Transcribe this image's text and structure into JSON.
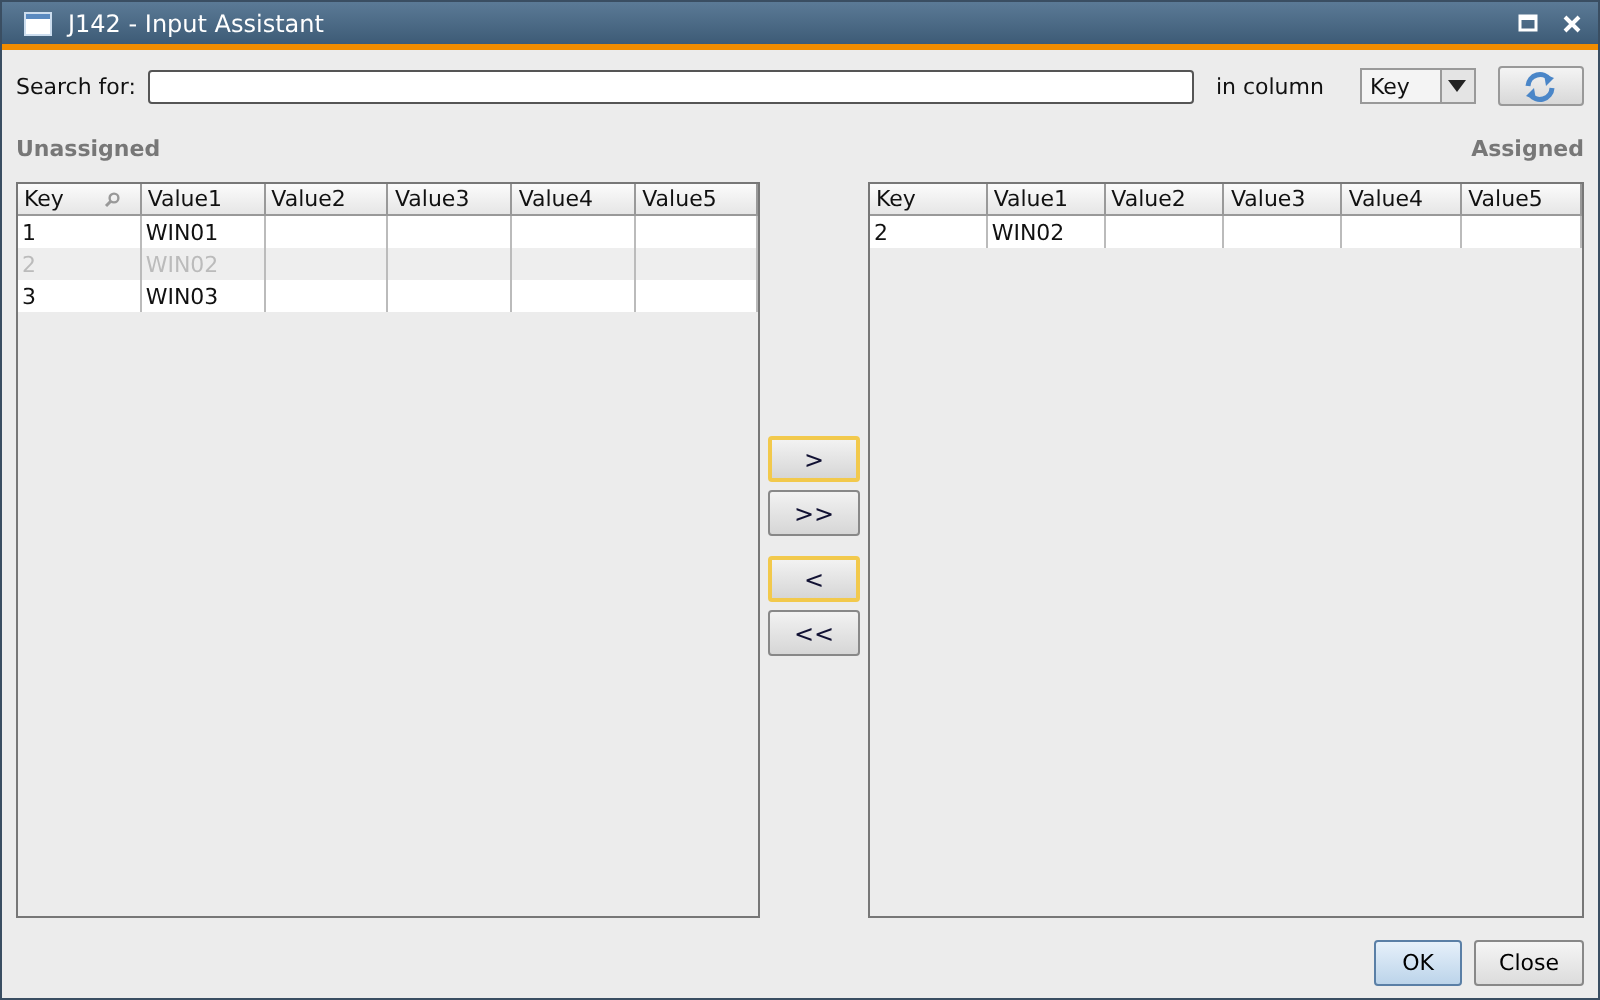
{
  "window": {
    "title": "J142 - Input Assistant"
  },
  "search": {
    "label": "Search for:",
    "column_label": "in column",
    "column_value": "Key"
  },
  "unassigned": {
    "title": "Unassigned",
    "columns": [
      "Key",
      "Value1",
      "Value2",
      "Value3",
      "Value4",
      "Value5"
    ],
    "key_search_icon": true,
    "rows": [
      {
        "cells": [
          "1",
          "WIN01",
          "",
          "",
          "",
          ""
        ],
        "disabled": false
      },
      {
        "cells": [
          "2",
          "WIN02",
          "",
          "",
          "",
          ""
        ],
        "disabled": true
      },
      {
        "cells": [
          "3",
          "WIN03",
          "",
          "",
          "",
          ""
        ],
        "disabled": false
      }
    ]
  },
  "assigned": {
    "title": "Assigned",
    "columns": [
      "Key",
      "Value1",
      "Value2",
      "Value3",
      "Value4",
      "Value5"
    ],
    "rows": [
      {
        "cells": [
          "2",
          "WIN02",
          "",
          "",
          "",
          ""
        ],
        "disabled": false
      }
    ]
  },
  "move_groups": [
    {
      "buttons": [
        {
          "label": ">",
          "highlighted": true
        },
        {
          "label": ">>",
          "highlighted": false
        }
      ]
    },
    {
      "buttons": [
        {
          "label": "<",
          "highlighted": true
        },
        {
          "label": "<<",
          "highlighted": false
        }
      ]
    }
  ],
  "buttons": [
    {
      "label": "OK",
      "default": true
    },
    {
      "label": "Close",
      "default": false
    }
  ]
}
